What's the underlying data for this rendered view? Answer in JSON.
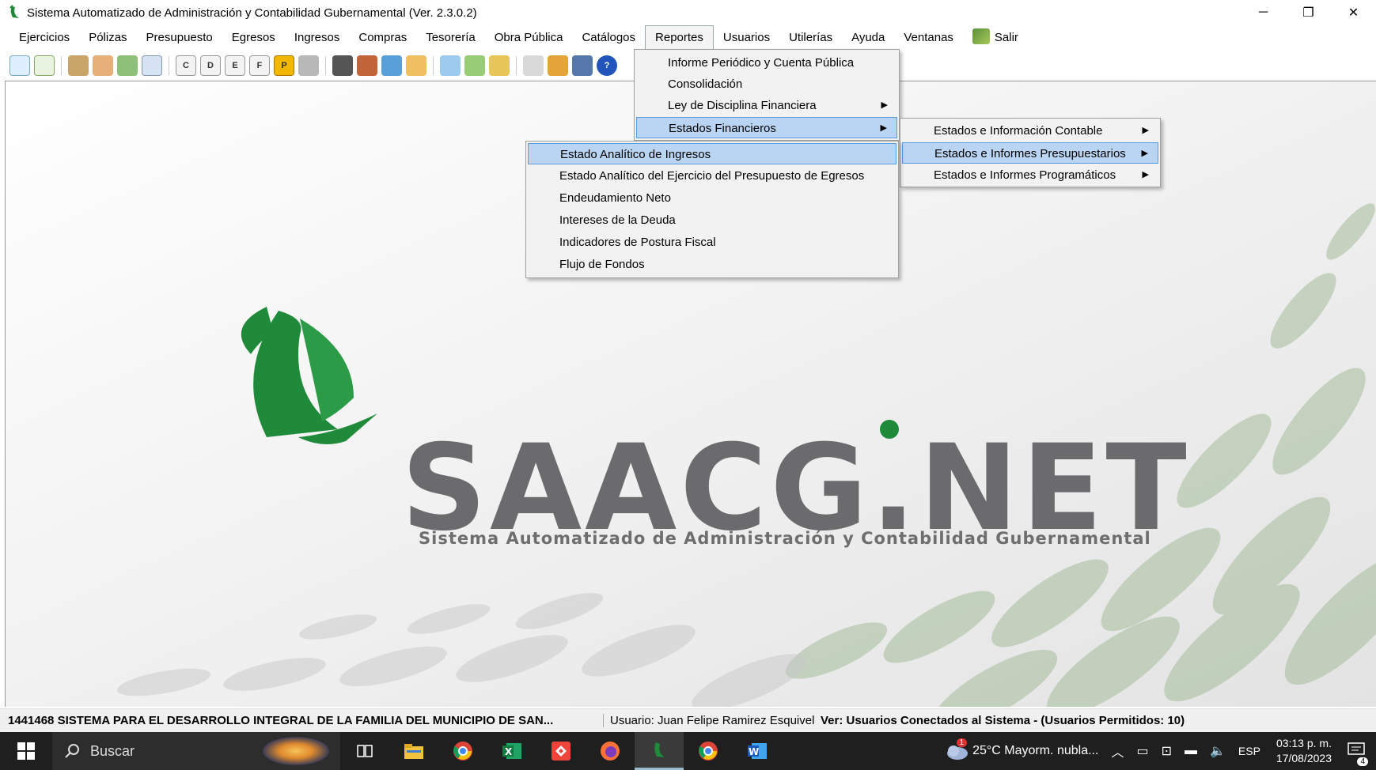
{
  "window": {
    "title": "Sistema Automatizado de Administración y Contabilidad Gubernamental  (Ver. 2.3.0.2)",
    "minimize": "─",
    "restore": "❐",
    "close": "✕"
  },
  "menubar": {
    "items": [
      "Ejercicios",
      "Pólizas",
      "Presupuesto",
      "Egresos",
      "Ingresos",
      "Compras",
      "Tesorería",
      "Obra Pública",
      "Catálogos",
      "Reportes",
      "Usuarios",
      "Utilerías",
      "Ayuda",
      "Ventanas"
    ],
    "salir": "Salir"
  },
  "toolbar": {
    "letter_buttons": [
      "C",
      "D",
      "E",
      "F",
      "P"
    ]
  },
  "reportes_menu": {
    "items": [
      "Informe Periódico y Cuenta Pública",
      "Consolidación",
      "Ley de Disciplina Financiera",
      "Estados Financieros"
    ]
  },
  "estados_submenu": {
    "items": [
      "Estados e Información Contable",
      "Estados e Informes Presupuestarios",
      "Estados e Informes Programáticos"
    ]
  },
  "presupuestarios_submenu": {
    "items": [
      "Estado Analítico de Ingresos",
      "Estado Analítico del Ejercicio del Presupuesto de Egresos",
      "Endeudamiento Neto",
      "Intereses de la Deuda",
      "Indicadores de Postura Fiscal",
      "Flujo de Fondos"
    ]
  },
  "logo": {
    "text": "SAACG.NET",
    "subtitle": "Sistema Automatizado de Administración y Contabilidad Gubernamental"
  },
  "statusbar": {
    "organization": "1441468 SISTEMA PARA EL DESARROLLO INTEGRAL DE LA FAMILIA DEL MUNICIPIO DE SAN...",
    "user": "Usuario: Juan Felipe Ramirez Esquivel",
    "connected": "Ver: Usuarios Conectados al Sistema - (Usuarios Permitidos: 10)"
  },
  "taskbar": {
    "search_placeholder": "Buscar",
    "weather": "25°C  Mayorm. nubla...",
    "weather_badge": "1",
    "language": "ESP",
    "time": "03:13 p. m.",
    "date": "17/08/2023",
    "notification_count": "4"
  },
  "colors": {
    "brand_green": "#1f8a3a",
    "logo_gray": "#6b6b6d",
    "menu_highlight": "#b9d5f3"
  }
}
